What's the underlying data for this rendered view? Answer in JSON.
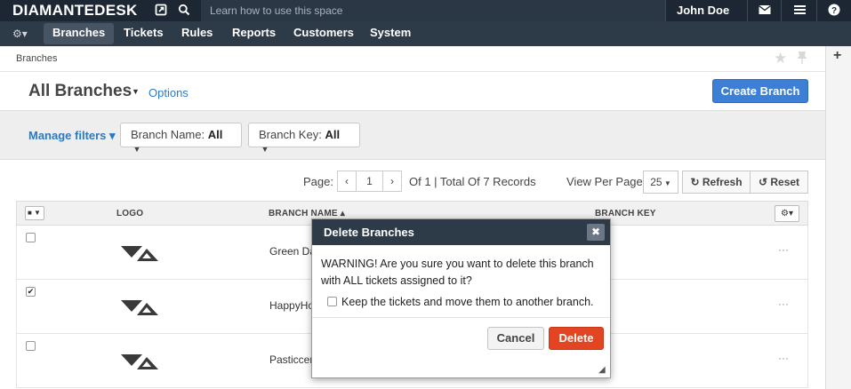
{
  "topbar": {
    "brand": "DIAMANTEDESK",
    "search_placeholder": "Learn how to use this space",
    "user": "John Doe ▾"
  },
  "nav": {
    "items": [
      "Branches",
      "Tickets",
      "Rules",
      "Reports",
      "Customers",
      "System"
    ],
    "active": "Branches"
  },
  "breadcrumb": "Branches",
  "page": {
    "title": "All Branches",
    "options_label": "Options",
    "create_button": "Create Branch"
  },
  "filters": {
    "manage_label": "Manage filters ▾",
    "branch_name_label": "Branch Name:",
    "branch_name_value": "All",
    "branch_key_label": "Branch Key:",
    "branch_key_value": "All"
  },
  "pagination": {
    "page_label": "Page:",
    "current_page": "1",
    "summary": "Of 1 | Total Of 7 Records",
    "view_per_page_label": "View Per Page:",
    "per_page": "25",
    "refresh_label": "Refresh",
    "reset_label": "Reset"
  },
  "table": {
    "columns": [
      "LOGO",
      "BRANCH NAME ▴",
      "BRANCH KEY"
    ],
    "rows": [
      {
        "name": "Green Da",
        "checked": false
      },
      {
        "name": "HappyHo",
        "checked": true
      },
      {
        "name": "Pasticcer",
        "checked": false
      }
    ]
  },
  "modal": {
    "title": "Delete Branches",
    "message": "WARNING! Are you sure you want to delete this branch with ALL tickets assigned to it?",
    "keep_option": "Keep the tickets and move them to another branch.",
    "cancel_label": "Cancel",
    "delete_label": "Delete"
  },
  "colors": {
    "topbar": "#1c2733",
    "navbar": "#2d3a48",
    "primary": "#3b7fd6",
    "danger": "#e34421",
    "link": "#2a7ac3"
  }
}
